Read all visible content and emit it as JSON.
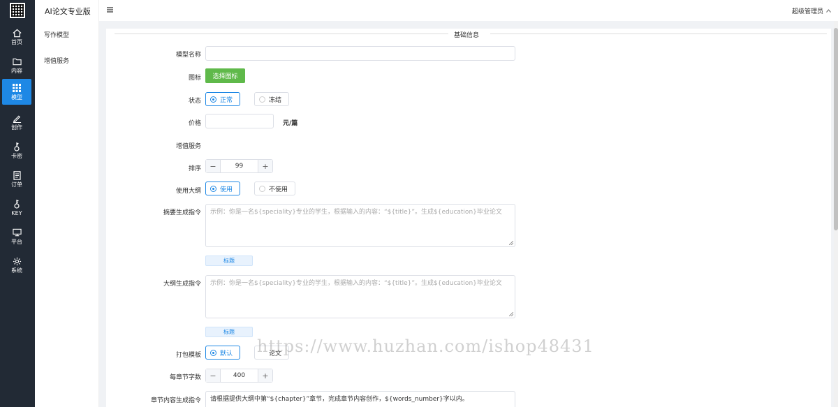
{
  "nav": {
    "items": [
      {
        "label": "首页",
        "icon": "home-icon"
      },
      {
        "label": "内容",
        "icon": "folder-icon"
      },
      {
        "label": "模型",
        "icon": "grid-icon"
      },
      {
        "label": "创作",
        "icon": "pen-icon"
      },
      {
        "label": "卡密",
        "icon": "key-icon"
      },
      {
        "label": "订单",
        "icon": "document-icon"
      },
      {
        "label": "KEY",
        "icon": "key-icon"
      },
      {
        "label": "平台",
        "icon": "monitor-icon"
      },
      {
        "label": "系统",
        "icon": "gear-icon"
      }
    ],
    "active_index": 2,
    "accent_color": "#1e88e5",
    "background_color": "#222a35"
  },
  "sidebar": {
    "title": "AI论文专业版",
    "items": [
      {
        "label": "写作模型"
      },
      {
        "label": "增值服务"
      }
    ]
  },
  "header": {
    "user": "超级管理员"
  },
  "form": {
    "section_title": "基础信息",
    "model_name": {
      "label": "模型名称",
      "value": ""
    },
    "icon": {
      "label": "图标",
      "button": "选择图标"
    },
    "status": {
      "label": "状态",
      "options": [
        "正常",
        "冻结"
      ],
      "selected": "正常"
    },
    "price": {
      "label": "价格",
      "value": "",
      "unit": "元/篇"
    },
    "addon_service": {
      "label": "增值服务"
    },
    "sort": {
      "label": "排序",
      "value": "99"
    },
    "use_outline": {
      "label": "使用大纲",
      "options": [
        "使用",
        "不使用"
      ],
      "selected": "使用"
    },
    "abstract_prompt": {
      "label": "摘要生成指令",
      "placeholder": "示例：你是一名${speciality}专业的学生，根据输入的内容：“${title}”。生成${education}毕业论文",
      "tag": "标题"
    },
    "outline_prompt": {
      "label": "大纲生成指令",
      "placeholder": "示例：你是一名${speciality}专业的学生，根据输入的内容：“${title}”。生成${education}毕业论文",
      "tag": "标题"
    },
    "package_template": {
      "label": "打包模板",
      "options": [
        "默认",
        "论文"
      ],
      "selected": "默认"
    },
    "chapter_words": {
      "label": "每章节字数",
      "value": "400"
    },
    "chapter_prompt": {
      "label": "章节内容生成指令",
      "value": "请根据提供大纲中第“${chapter}”章节，完成章节内容创作，${words_number}字以内。"
    }
  },
  "watermark": "https://www.huzhan.com/ishop48431",
  "colors": {
    "primary": "#1e88e5",
    "success": "#5fb94a"
  }
}
